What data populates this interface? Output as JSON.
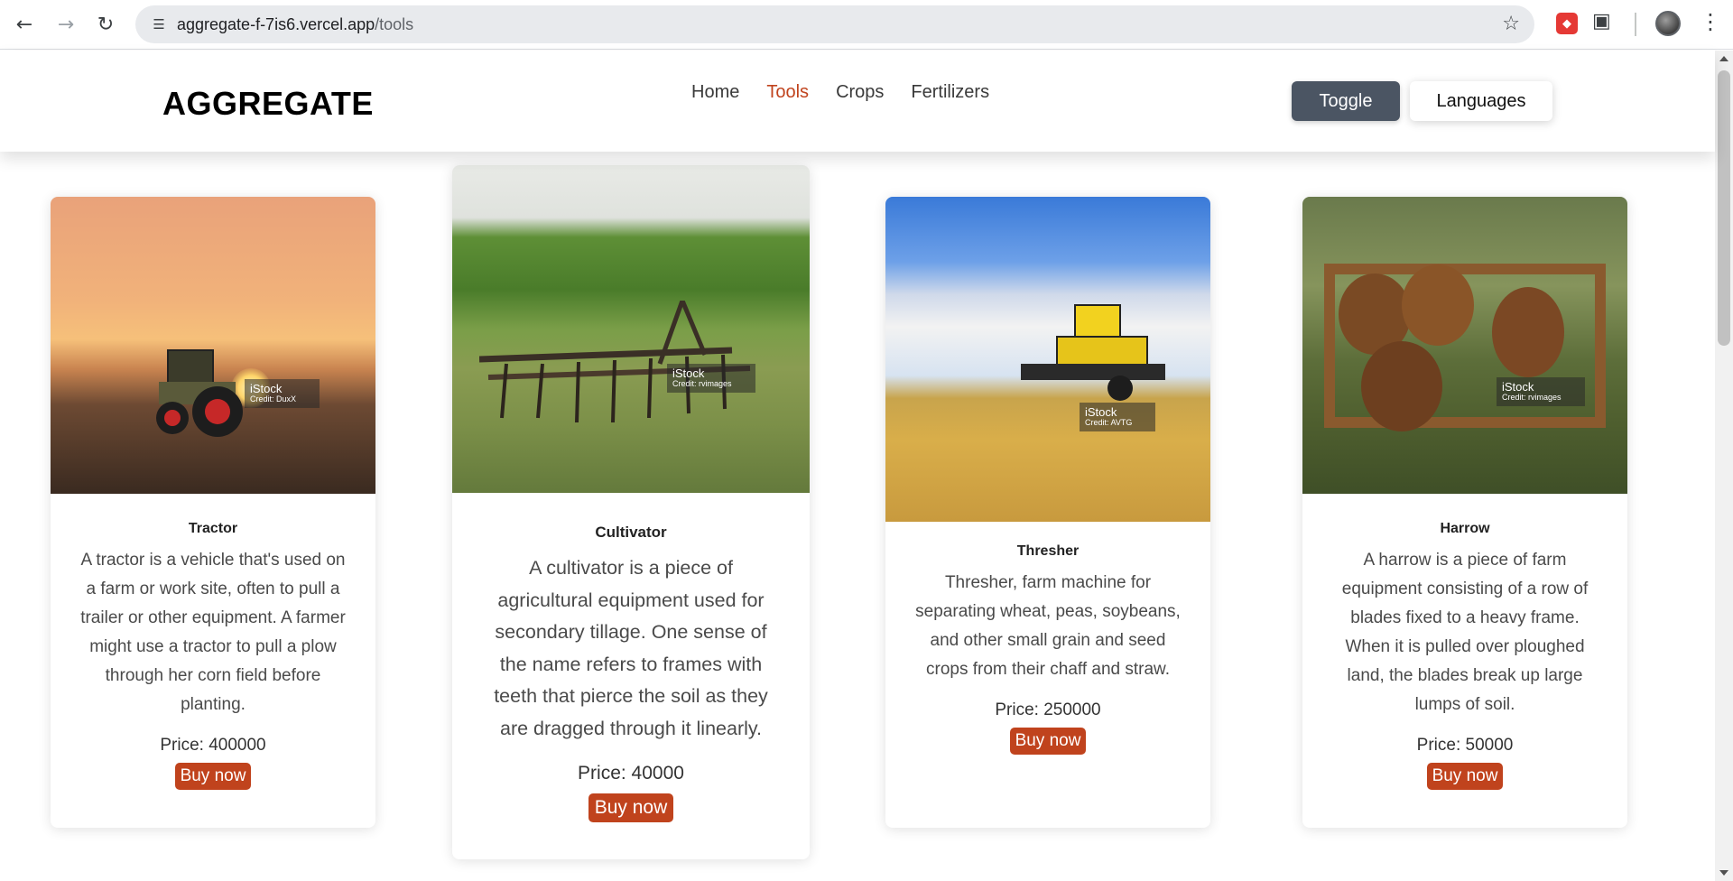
{
  "browser": {
    "url_domain": "aggregate-f-7is6.vercel.app",
    "url_path": "/tools",
    "icons": [
      "back-icon",
      "forward-icon",
      "reload-icon",
      "site-settings-icon",
      "star-icon",
      "extension-icon",
      "puzzle-icon",
      "profile-avatar",
      "menu-icon"
    ]
  },
  "header": {
    "logo": "AGGREGATE",
    "nav": [
      "Home",
      "Tools",
      "Crops",
      "Fertilizers"
    ],
    "active_nav": "Tools",
    "toggle_label": "Toggle",
    "languages_label": "Languages"
  },
  "colors": {
    "accent": "#c0431d",
    "toggle_bg": "#4b5563"
  },
  "cards": [
    {
      "title": "Tractor",
      "description": "A tractor is a vehicle that's used on a farm or work site, often to pull a trailer or other equipment. A farmer might use a tractor to pull a plow through her corn field before planting.",
      "price": "Price: 400000",
      "buy_label": "Buy now",
      "credit_brand": "iStock",
      "credit_author": "Credit: DuxX"
    },
    {
      "title": "Cultivator",
      "description": "A cultivator is a piece of agricultural equipment used for secondary tillage. One sense of the name refers to frames with teeth that pierce the soil as they are dragged through it linearly.",
      "price": "Price: 40000",
      "buy_label": "Buy now",
      "credit_brand": "iStock",
      "credit_author": "Credit: rvimages"
    },
    {
      "title": "Thresher",
      "description": "Thresher, farm machine for separating wheat, peas, soybeans, and other small grain and seed crops from their chaff and straw.",
      "price": "Price: 250000",
      "buy_label": "Buy now",
      "credit_brand": "iStock",
      "credit_author": "Credit: AVTG"
    },
    {
      "title": "Harrow",
      "description": "A harrow is a piece of farm equipment consisting of a row of blades fixed to a heavy frame. When it is pulled over ploughed land, the blades break up large lumps of soil.",
      "price": "Price: 50000",
      "buy_label": "Buy now",
      "credit_brand": "iStock",
      "credit_author": "Credit: rvimages"
    }
  ]
}
